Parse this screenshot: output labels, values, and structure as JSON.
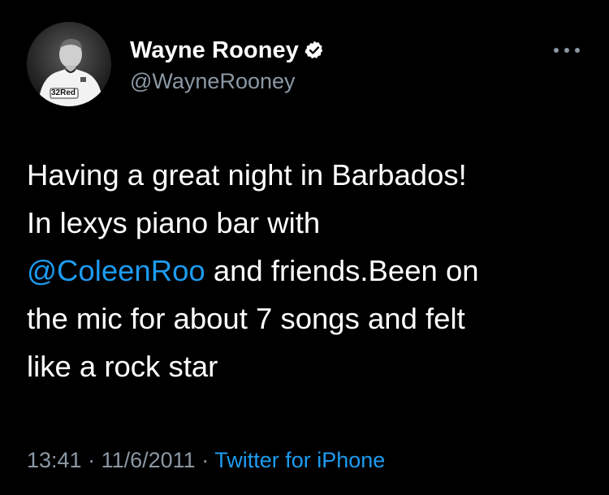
{
  "user": {
    "display_name": "Wayne Rooney",
    "handle": "@WayneRooney",
    "verified": true,
    "avatar_shirt_sponsor": "32Red"
  },
  "tweet": {
    "text_line1": "Having a great night in Barbados!",
    "text_line2": "In lexys piano bar with",
    "mention": "@ColeenRoo",
    "text_line3_rest": " and friends.Been on",
    "text_line4": "the mic for about 7 songs and felt",
    "text_line5": "like a rock star"
  },
  "meta": {
    "time": "13:41",
    "separator": " · ",
    "date": "11/6/2011",
    "source": "Twitter for iPhone"
  },
  "icons": {
    "more": "more-horizontal-icon",
    "verified": "verified-badge-icon"
  },
  "colors": {
    "background": "#000000",
    "text": "#ffffff",
    "secondary": "#8b98a5",
    "link": "#1d9bf0"
  }
}
